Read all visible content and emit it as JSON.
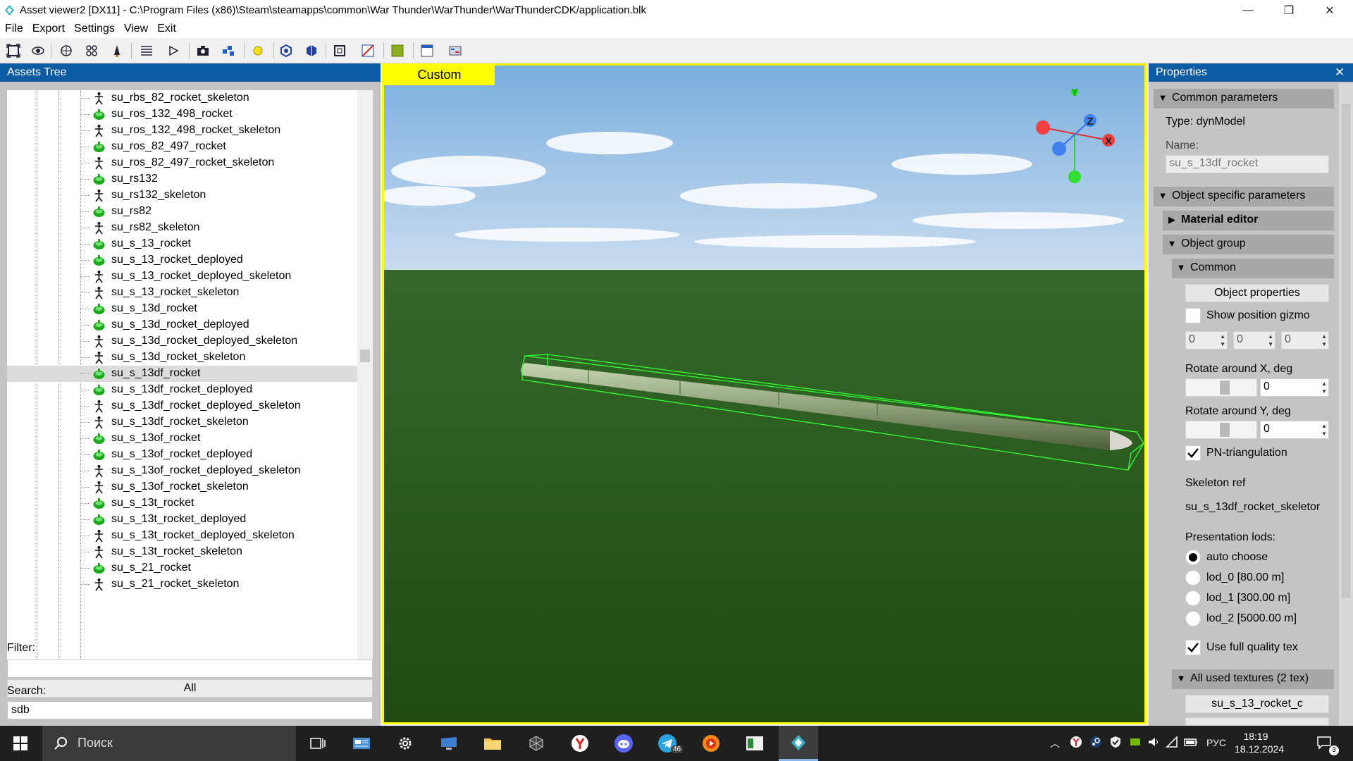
{
  "window": {
    "title": "Asset viewer2  [DX11]  - C:\\Program Files (x86)\\Steam\\steamapps\\common\\War Thunder\\WarThunder\\WarThunderCDK/application.blk",
    "minimize": "—",
    "maximize": "❐",
    "close": "✕"
  },
  "menu": [
    {
      "label": "File"
    },
    {
      "label": "Export"
    },
    {
      "label": "Settings"
    },
    {
      "label": "View"
    },
    {
      "label": "Exit"
    }
  ],
  "left_panel": {
    "header": "Assets Tree",
    "tree": [
      {
        "label": "su_rbs_82_rocket_skeleton",
        "icon": "skeleton-icon"
      },
      {
        "label": "su_ros_132_498_rocket",
        "icon": "dynmodel-icon"
      },
      {
        "label": "su_ros_132_498_rocket_skeleton",
        "icon": "skeleton-icon"
      },
      {
        "label": "su_ros_82_497_rocket",
        "icon": "dynmodel-icon"
      },
      {
        "label": "su_ros_82_497_rocket_skeleton",
        "icon": "skeleton-icon"
      },
      {
        "label": "su_rs132",
        "icon": "dynmodel-icon"
      },
      {
        "label": "su_rs132_skeleton",
        "icon": "skeleton-icon"
      },
      {
        "label": "su_rs82",
        "icon": "dynmodel-icon"
      },
      {
        "label": "su_rs82_skeleton",
        "icon": "skeleton-icon"
      },
      {
        "label": "su_s_13_rocket",
        "icon": "dynmodel-icon"
      },
      {
        "label": "su_s_13_rocket_deployed",
        "icon": "dynmodel-icon"
      },
      {
        "label": "su_s_13_rocket_deployed_skeleton",
        "icon": "skeleton-icon"
      },
      {
        "label": "su_s_13_rocket_skeleton",
        "icon": "skeleton-icon"
      },
      {
        "label": "su_s_13d_rocket",
        "icon": "dynmodel-icon"
      },
      {
        "label": "su_s_13d_rocket_deployed",
        "icon": "dynmodel-icon"
      },
      {
        "label": "su_s_13d_rocket_deployed_skeleton",
        "icon": "skeleton-icon"
      },
      {
        "label": "su_s_13d_rocket_skeleton",
        "icon": "skeleton-icon"
      },
      {
        "label": "su_s_13df_rocket",
        "icon": "dynmodel-icon",
        "selected": true
      },
      {
        "label": "su_s_13df_rocket_deployed",
        "icon": "dynmodel-icon"
      },
      {
        "label": "su_s_13df_rocket_deployed_skeleton",
        "icon": "skeleton-icon"
      },
      {
        "label": "su_s_13df_rocket_skeleton",
        "icon": "skeleton-icon"
      },
      {
        "label": "su_s_13of_rocket",
        "icon": "dynmodel-icon"
      },
      {
        "label": "su_s_13of_rocket_deployed",
        "icon": "dynmodel-icon"
      },
      {
        "label": "su_s_13of_rocket_deployed_skeleton",
        "icon": "skeleton-icon"
      },
      {
        "label": "su_s_13of_rocket_skeleton",
        "icon": "skeleton-icon"
      },
      {
        "label": "su_s_13t_rocket",
        "icon": "dynmodel-icon"
      },
      {
        "label": "su_s_13t_rocket_deployed",
        "icon": "dynmodel-icon"
      },
      {
        "label": "su_s_13t_rocket_deployed_skeleton",
        "icon": "skeleton-icon"
      },
      {
        "label": "su_s_13t_rocket_skeleton",
        "icon": "skeleton-icon"
      },
      {
        "label": "su_s_21_rocket",
        "icon": "dynmodel-icon"
      },
      {
        "label": "su_s_21_rocket_skeleton",
        "icon": "skeleton-icon"
      }
    ],
    "filter_button": "All",
    "filter_label": "Filter:",
    "filter_value": "",
    "search_label": "Search:",
    "search_value": "sdb"
  },
  "viewport": {
    "tab": "Custom",
    "gizmo": {
      "x": "X",
      "y": "Y",
      "z": "Z"
    }
  },
  "right_panel": {
    "header": "Properties",
    "close": "✕",
    "common_parameters": "Common parameters",
    "type": "Type: dynModel",
    "name_label": "Name:",
    "name_value": "su_s_13df_rocket",
    "object_specific": "Object specific parameters",
    "material_editor": "Material editor",
    "object_group": "Object group",
    "common": "Common",
    "object_properties": "Object properties",
    "show_position_gizmo": "Show position gizmo",
    "pos_values": [
      "0",
      "0",
      "0"
    ],
    "rotate_x_label": "Rotate around X, deg",
    "rotate_x_value": "0",
    "rotate_y_label": "Rotate around Y, deg",
    "rotate_y_value": "0",
    "pn_triangulation": "PN-triangulation",
    "skeleton_ref_label": "Skeleton ref",
    "skeleton_ref_value": "su_s_13df_rocket_skeletor",
    "presentation_lods": "Presentation lods:",
    "lods": [
      {
        "label": "auto choose",
        "checked": true
      },
      {
        "label": "lod_0 [80.00 m]",
        "checked": false
      },
      {
        "label": "lod_1 [300.00 m]",
        "checked": false
      },
      {
        "label": "lod_2 [5000.00 m]",
        "checked": false
      }
    ],
    "use_full_quality": "Use full quality tex",
    "all_used_textures": "All used textures (2 tex)",
    "texture_1": "su_s_13_rocket_c"
  },
  "taskbar": {
    "search_placeholder": "Поиск",
    "language": "РУС",
    "time": "18:19",
    "date": "18.12.2024",
    "notifications": "3",
    "telegram_badge": "46"
  },
  "colors": {
    "accent": "#0c5ba3",
    "viewport_border": "#ffff00",
    "sky_top": "#7fb0e0",
    "ground": "#2a5a1c",
    "bbox": "#33ff33"
  }
}
